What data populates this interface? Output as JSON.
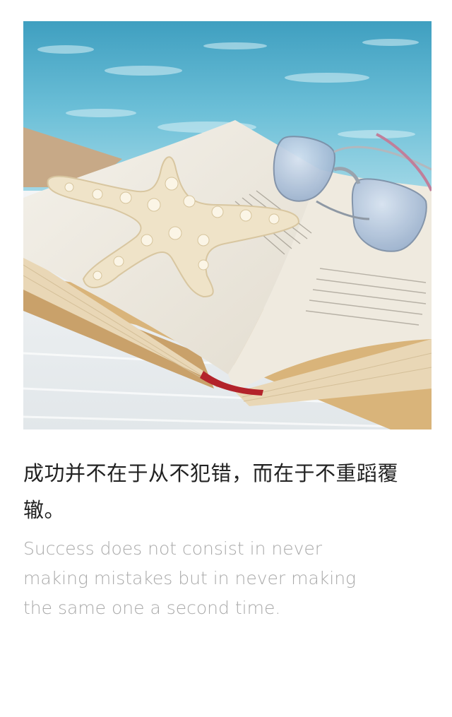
{
  "card": {
    "image_subject": "open book with starfish and sunglasses by the pool",
    "quote_cn": "成功并不在于从不犯错，而在于不重蹈覆辙。",
    "quote_en": "Success does not consist in never making mistakes but in never making the same one a second time."
  },
  "colors": {
    "quote_cn": "#222222",
    "quote_en": "#aaaaaa",
    "background": "#ffffff"
  }
}
